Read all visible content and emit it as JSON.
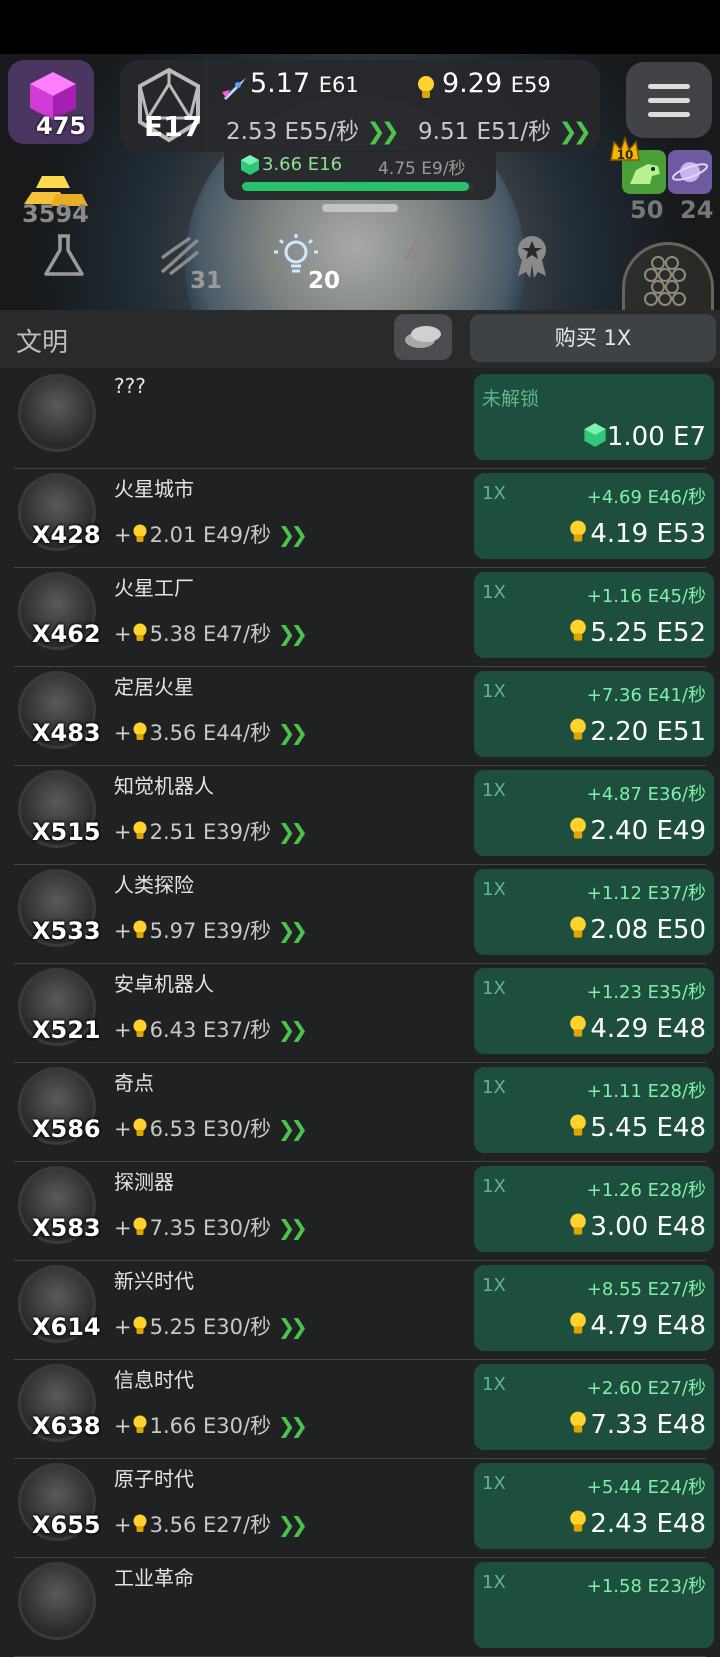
{
  "hud": {
    "gems": "475",
    "level": "E17",
    "rocket_value": "5.17",
    "rocket_exp": "E61",
    "rocket_rate": "2.53 E55/秒",
    "bulb_value": "9.29",
    "bulb_exp": "E59",
    "bulb_rate": "9.51 E51/秒",
    "crystal_value": "3.66 E16",
    "crystal_rate": "4.75 E9/秒",
    "crystal_progress": 0.98,
    "gold": "3594",
    "dino_badge": "10",
    "dino_count": "50",
    "saturn_count": "24"
  },
  "tabs": [
    {
      "name": "research",
      "num": ""
    },
    {
      "name": "dna",
      "num": "31"
    },
    {
      "name": "ideas",
      "num": "20"
    },
    {
      "name": "power",
      "num": ""
    },
    {
      "name": "achievements",
      "num": ""
    }
  ],
  "section": {
    "title": "文明",
    "buy_label": "购买 1X"
  },
  "items": [
    {
      "name": "???",
      "count": "",
      "locked": true,
      "lock_label": "未解锁",
      "cost": "1.00 E7"
    },
    {
      "name": "火星城市",
      "count": "X428",
      "income": "2.01 E49/秒",
      "mult": "1X",
      "gain": "+4.69 E46/秒",
      "cost": "4.19 E53"
    },
    {
      "name": "火星工厂",
      "count": "X462",
      "income": "5.38 E47/秒",
      "mult": "1X",
      "gain": "+1.16 E45/秒",
      "cost": "5.25 E52"
    },
    {
      "name": "定居火星",
      "count": "X483",
      "income": "3.56 E44/秒",
      "mult": "1X",
      "gain": "+7.36 E41/秒",
      "cost": "2.20 E51"
    },
    {
      "name": "知觉机器人",
      "count": "X515",
      "income": "2.51 E39/秒",
      "mult": "1X",
      "gain": "+4.87 E36/秒",
      "cost": "2.40 E49"
    },
    {
      "name": "人类探险",
      "count": "X533",
      "income": "5.97 E39/秒",
      "mult": "1X",
      "gain": "+1.12 E37/秒",
      "cost": "2.08 E50"
    },
    {
      "name": "安卓机器人",
      "count": "X521",
      "income": "6.43 E37/秒",
      "mult": "1X",
      "gain": "+1.23 E35/秒",
      "cost": "4.29 E48"
    },
    {
      "name": "奇点",
      "count": "X586",
      "income": "6.53 E30/秒",
      "mult": "1X",
      "gain": "+1.11 E28/秒",
      "cost": "5.45 E48"
    },
    {
      "name": "探测器",
      "count": "X583",
      "income": "7.35 E30/秒",
      "mult": "1X",
      "gain": "+1.26 E28/秒",
      "cost": "3.00 E48"
    },
    {
      "name": "新兴时代",
      "count": "X614",
      "income": "5.25 E30/秒",
      "mult": "1X",
      "gain": "+8.55 E27/秒",
      "cost": "4.79 E48"
    },
    {
      "name": "信息时代",
      "count": "X638",
      "income": "1.66 E30/秒",
      "mult": "1X",
      "gain": "+2.60 E27/秒",
      "cost": "7.33 E48"
    },
    {
      "name": "原子时代",
      "count": "X655",
      "income": "3.56 E27/秒",
      "mult": "1X",
      "gain": "+5.44 E24/秒",
      "cost": "2.43 E48"
    },
    {
      "name": "工业革命",
      "count": "",
      "income": "",
      "mult": "1X",
      "gain": "+1.58 E23/秒",
      "cost": ""
    }
  ]
}
